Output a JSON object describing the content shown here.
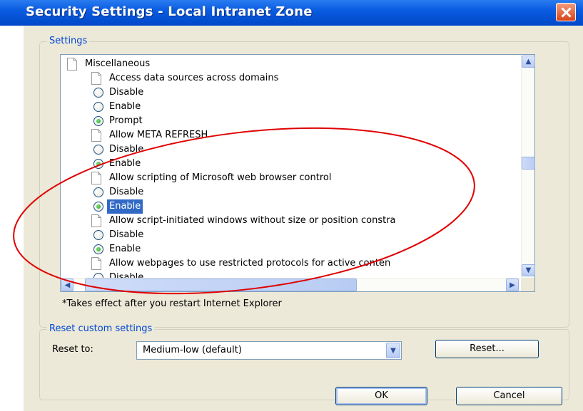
{
  "window": {
    "title": "Security Settings - Local Intranet Zone",
    "close_icon": "close-icon"
  },
  "settings_group": {
    "legend": "Settings",
    "tree": [
      {
        "type": "category",
        "label": "Miscellaneous"
      },
      {
        "type": "setting",
        "label": "Access data sources across domains"
      },
      {
        "type": "option",
        "label": "Disable",
        "checked": false
      },
      {
        "type": "option",
        "label": "Enable",
        "checked": false
      },
      {
        "type": "option",
        "label": "Prompt",
        "checked": true
      },
      {
        "type": "setting",
        "label": "Allow META REFRESH"
      },
      {
        "type": "option",
        "label": "Disable",
        "checked": false
      },
      {
        "type": "option",
        "label": "Enable",
        "checked": true
      },
      {
        "type": "setting",
        "label": "Allow scripting of Microsoft web browser control"
      },
      {
        "type": "option",
        "label": "Disable",
        "checked": false
      },
      {
        "type": "option",
        "label": "Enable",
        "checked": true,
        "selected": true
      },
      {
        "type": "setting",
        "label": "Allow script-initiated windows without size or position constra"
      },
      {
        "type": "option",
        "label": "Disable",
        "checked": false
      },
      {
        "type": "option",
        "label": "Enable",
        "checked": true
      },
      {
        "type": "setting",
        "label": "Allow webpages to use restricted protocols for active conten"
      },
      {
        "type": "option",
        "label": "Disable",
        "checked": false
      }
    ],
    "note": "*Takes effect after you restart Internet Explorer"
  },
  "reset_group": {
    "legend": "Reset custom settings",
    "reset_to_label": "Reset to:",
    "selected_value": "Medium-low (default)",
    "reset_button": "Reset..."
  },
  "buttons": {
    "ok": "OK",
    "cancel": "Cancel"
  },
  "colors": {
    "title_bar": "#0a5ce0",
    "dialog_bg": "#ece9d8",
    "group_legend": "#0046d5",
    "selection": "#316ac5",
    "annotation": "#e00000"
  }
}
